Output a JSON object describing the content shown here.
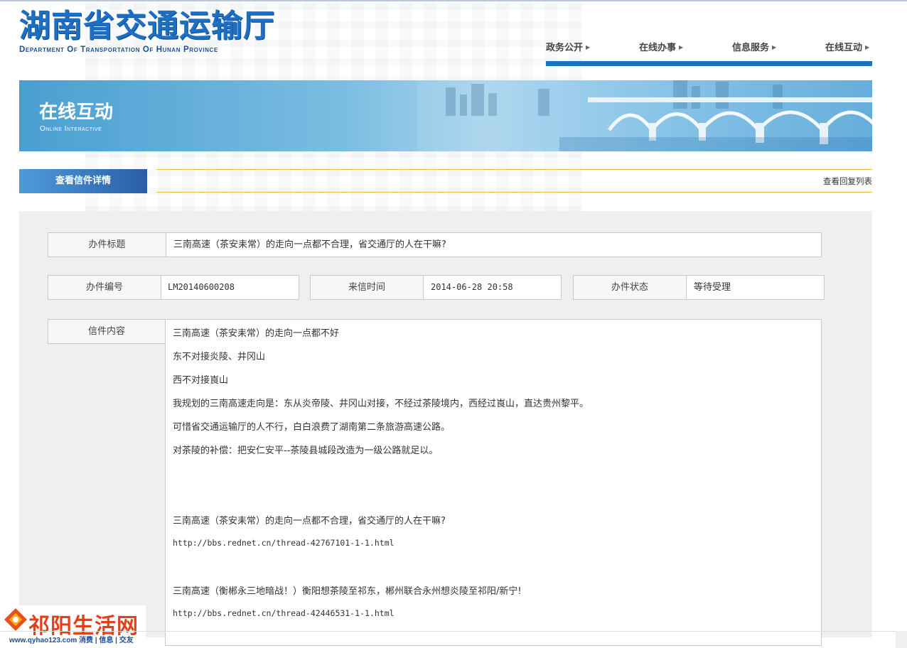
{
  "header": {
    "logo_cn": "湖南省交通运输厅",
    "logo_en": "Department Of Transportation Of Hunan Province"
  },
  "nav": {
    "items": [
      {
        "label": "政务公开"
      },
      {
        "label": "在线办事"
      },
      {
        "label": "信息服务"
      },
      {
        "label": "在线互动"
      }
    ],
    "accent_color": "#1a72b8"
  },
  "banner": {
    "title": "在线互动",
    "subtitle": "Online Interactive"
  },
  "tabs": {
    "active_label": "查看信件详情",
    "reply_link": "查看回复列表"
  },
  "letter": {
    "title_label": "办件标题",
    "title_value": "三南高速（茶安耒常）的走向一点都不合理，省交通厅的人在干嘛?",
    "number_label": "办件编号",
    "number_value": "LM20140600208",
    "time_label": "来信时间",
    "time_value": "2014-06-28 20:58",
    "status_label": "办件状态",
    "status_value": "等待受理",
    "content_label": "信件内容",
    "content_lines": [
      "三南高速（茶安耒常）的走向一点都不好",
      "东不对接炎陵、井冈山",
      "西不对接崀山",
      "我规划的三南高速走向是：东从炎帝陵、井冈山对接，不经过茶陵境内，西经过崀山，直达贵州黎平。",
      "可惜省交通运输厅的人不行，白白浪费了湖南第二条旅游高速公路。",
      "对茶陵的补偿：把安仁安平--茶陵县城段改造为一级公路就足以。",
      "三南高速（茶安耒常）的走向一点都不合理，省交通厅的人在干嘛?",
      "http://bbs.rednet.cn/thread-42767101-1-1.html",
      "三南高速（衡郴永三地暗战！）衡阳想茶陵至祁东，郴州联合永州想炎陵至祁阳/新宁!",
      "http://bbs.rednet.cn/thread-42446531-1-1.html"
    ]
  },
  "watermark": {
    "title": "祁阳生活网",
    "sub": "www.qyhao123.com 消费 | 信息 | 交友"
  }
}
